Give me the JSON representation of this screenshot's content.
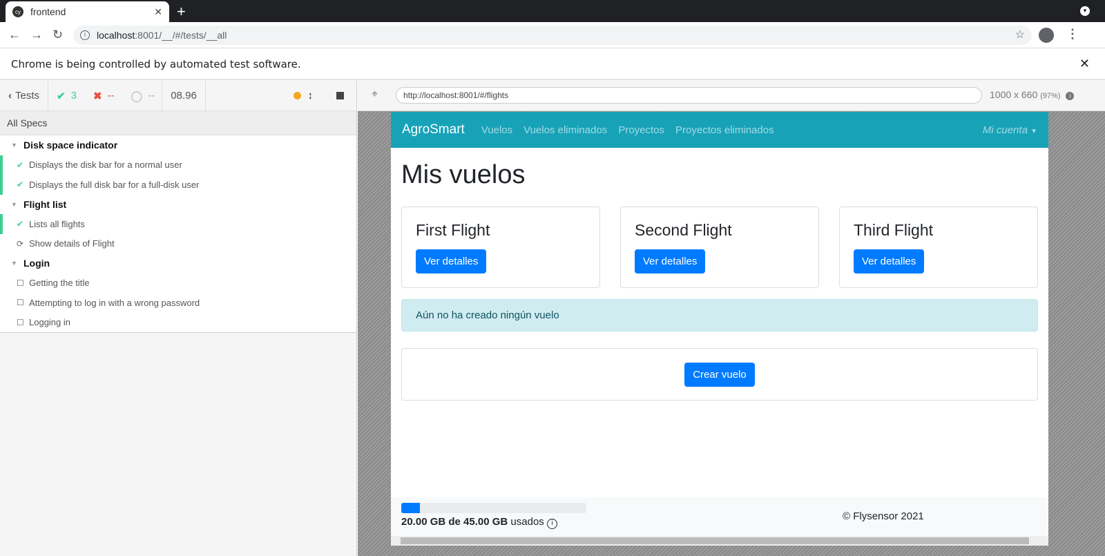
{
  "browser": {
    "tab_title": "frontend",
    "url_host": "localhost",
    "url_rest": ":8001/__/#/tests/__all",
    "infobar": "Chrome is being controlled by automated test software."
  },
  "runner": {
    "back_label": "Tests",
    "passed": "3",
    "failed": "--",
    "pending": "--",
    "duration": "08.96",
    "all_specs": "All Specs",
    "suites": [
      {
        "title": "Disk space indicator",
        "tests": [
          {
            "title": "Displays the disk bar for a normal user",
            "state": "passed"
          },
          {
            "title": "Displays the full disk bar for a full-disk user",
            "state": "passed"
          }
        ]
      },
      {
        "title": "Flight list",
        "tests": [
          {
            "title": "Lists all flights",
            "state": "passed"
          },
          {
            "title": "Show details of Flight",
            "state": "running"
          }
        ]
      },
      {
        "title": "Login",
        "tests": [
          {
            "title": "Getting the title",
            "state": "pending"
          },
          {
            "title": "Attempting to log in with a wrong password",
            "state": "pending"
          },
          {
            "title": "Logging in",
            "state": "pending"
          }
        ]
      }
    ],
    "aut_url": "http://localhost:8001/#/flights",
    "viewport": "1000 x 660",
    "scale": "(97%)"
  },
  "app": {
    "brand": "AgroSmart",
    "nav": [
      "Vuelos",
      "Vuelos eliminados",
      "Proyectos",
      "Proyectos eliminados"
    ],
    "account": "Mi cuenta",
    "title": "Mis vuelos",
    "flights": [
      {
        "name": "First Flight",
        "button": "Ver detalles"
      },
      {
        "name": "Second Flight",
        "button": "Ver detalles"
      },
      {
        "name": "Third Flight",
        "button": "Ver detalles"
      }
    ],
    "alert": "Aún no ha creado ningún vuelo",
    "create_button": "Crear vuelo",
    "disk": {
      "used_label": "20.00 GB de 45.00 GB",
      "suffix": "usados",
      "fill_percent": 10
    },
    "copyright": "© Flysensor 2021"
  },
  "colors": {
    "navbar": "#17a2b8",
    "primary": "#007bff",
    "pass": "#3ecf8e",
    "fail": "#e94f3c"
  }
}
